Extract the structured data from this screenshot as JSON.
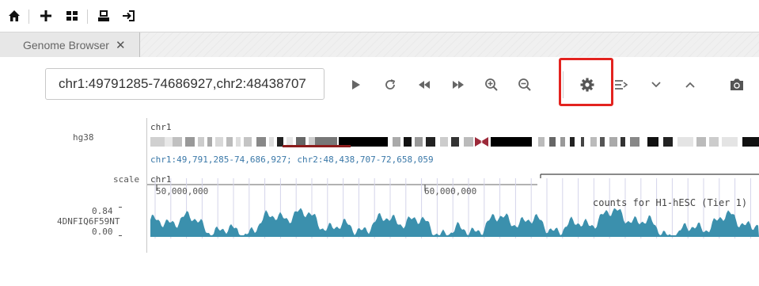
{
  "toolbar": {
    "icons": [
      "home-icon",
      "plus-icon",
      "grid-icon",
      "save-icon",
      "login-icon"
    ]
  },
  "tabs": [
    {
      "label": "Genome Browser",
      "close": "✕"
    }
  ],
  "navbar": {
    "locus_value": "chr1:49791285-74686927,chr2:48438707",
    "buttons": [
      "play",
      "refresh",
      "back",
      "forward",
      "zoom-in",
      "zoom-out",
      "settings",
      "menu",
      "chevron-down",
      "chevron-up",
      "camera"
    ],
    "highlighted": "settings"
  },
  "tracks": {
    "genome": "hg38",
    "chrom": "chr1",
    "locus_text": "chr1:49,791,285-74,686,927; chr2:48,438,707-72,658,059",
    "scale_label": "scale",
    "scale_chrom": "chr1",
    "tick1": "50,000,000",
    "tick2": "60,000,000",
    "signal_name": "4DNFIQ6F59NT",
    "signal_max": "0.84",
    "signal_min": "0.00",
    "signal_title": "counts for H1-hESC (Tier 1)"
  },
  "colors": {
    "accent": "#e3231f",
    "signal": "#3b90ad",
    "locus_text": "#3a78a8",
    "region_bar": "#8c1c1c"
  }
}
